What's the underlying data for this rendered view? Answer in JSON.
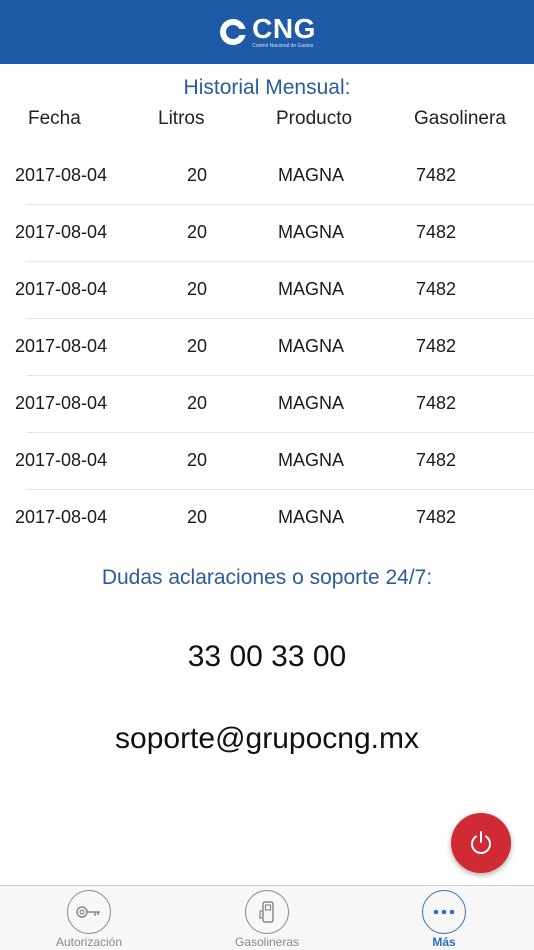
{
  "header": {
    "logo_text": "CNG",
    "logo_subtitle": "Control Nacional de Gastos",
    "brand_color": "#1f5aa6"
  },
  "history": {
    "title": "Historial Mensual:",
    "columns": [
      "Fecha",
      "Litros",
      "Producto",
      "Gasolinera"
    ],
    "rows": [
      {
        "fecha": "2017-08-04",
        "litros": "20",
        "producto": "MAGNA",
        "gasolinera": "7482"
      },
      {
        "fecha": "2017-08-04",
        "litros": "20",
        "producto": "MAGNA",
        "gasolinera": "7482"
      },
      {
        "fecha": "2017-08-04",
        "litros": "20",
        "producto": "MAGNA",
        "gasolinera": "7482"
      },
      {
        "fecha": "2017-08-04",
        "litros": "20",
        "producto": "MAGNA",
        "gasolinera": "7482"
      },
      {
        "fecha": "2017-08-04",
        "litros": "20",
        "producto": "MAGNA",
        "gasolinera": "7482"
      },
      {
        "fecha": "2017-08-04",
        "litros": "20",
        "producto": "MAGNA",
        "gasolinera": "7482"
      },
      {
        "fecha": "2017-08-04",
        "litros": "20",
        "producto": "MAGNA",
        "gasolinera": "7482"
      }
    ]
  },
  "support": {
    "title": "Dudas aclaraciones o soporte 24/7:",
    "phone": "33 00 33 00",
    "email": "soporte@grupocng.mx"
  },
  "power_button": {
    "icon": "power-icon",
    "color": "#d02a35"
  },
  "tabbar": {
    "active_color": "#2f6fc0",
    "tabs": [
      {
        "label": "Autorización",
        "icon": "key-icon"
      },
      {
        "label": "Gasolineras",
        "icon": "gas-pump-icon"
      },
      {
        "label": "Más",
        "icon": "more-icon"
      }
    ]
  }
}
